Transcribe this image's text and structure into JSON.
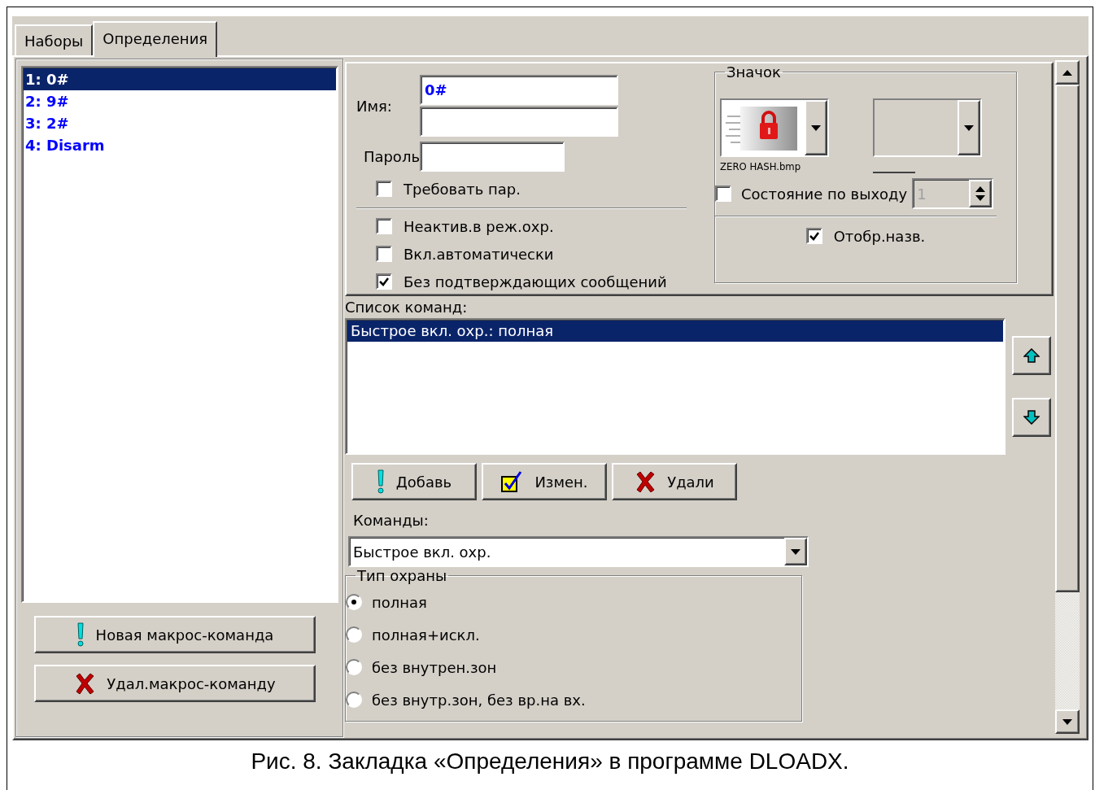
{
  "tabs": [
    {
      "label": "Наборы",
      "selected": false
    },
    {
      "label": "Определения",
      "selected": true
    }
  ],
  "macro_list": [
    {
      "label": "1: 0#",
      "selected": true
    },
    {
      "label": "2: 9#",
      "selected": false
    },
    {
      "label": "3: 2#",
      "selected": false
    },
    {
      "label": "4: Disarm",
      "selected": false
    }
  ],
  "macro_buttons": [
    {
      "label": "Новая макрос-команда",
      "kind": "add"
    },
    {
      "label": "Удал.макрос-команду",
      "kind": "delete"
    }
  ],
  "name": {
    "label": "Имя:",
    "value": "0#"
  },
  "password": {
    "label": "Пароль"
  },
  "require_password": {
    "label": "Требовать пар.",
    "checked": false
  },
  "options": [
    {
      "label": "Неактив.в реж.охр.",
      "checked": false
    },
    {
      "label": "Вкл.автоматически",
      "checked": false
    },
    {
      "label": "Без подтверждающих сообщений",
      "checked": true
    }
  ],
  "icon_group": {
    "title": "Значок",
    "file_name": "ZERO HASH.bmp",
    "output_state": {
      "label": "Состояние по выходу",
      "checked": false,
      "value": "1",
      "disabled": true
    },
    "show_name": {
      "label": "Отобр.назв.",
      "checked": true
    }
  },
  "command_list": {
    "label": "Список команд:",
    "items": [
      {
        "label": "Быстрое вкл. охр.: полная",
        "selected": true
      }
    ]
  },
  "command_buttons": [
    {
      "label": "Добавь",
      "kind": "add"
    },
    {
      "label": "Измен.",
      "kind": "edit"
    },
    {
      "label": "Удали",
      "kind": "delete"
    }
  ],
  "commands": {
    "label": "Команды:",
    "value": "Быстрое вкл. охр."
  },
  "arm_type": {
    "title": "Тип охраны",
    "options": [
      {
        "label": "полная",
        "selected": true
      },
      {
        "label": "полная+искл.",
        "selected": false
      },
      {
        "label": "без внутрен.зон",
        "selected": false
      },
      {
        "label": "без внутр.зон, без вр.на вх.",
        "selected": false
      }
    ]
  },
  "caption": "Рис. 8. Закладка «Определения» в программе DLOADX."
}
